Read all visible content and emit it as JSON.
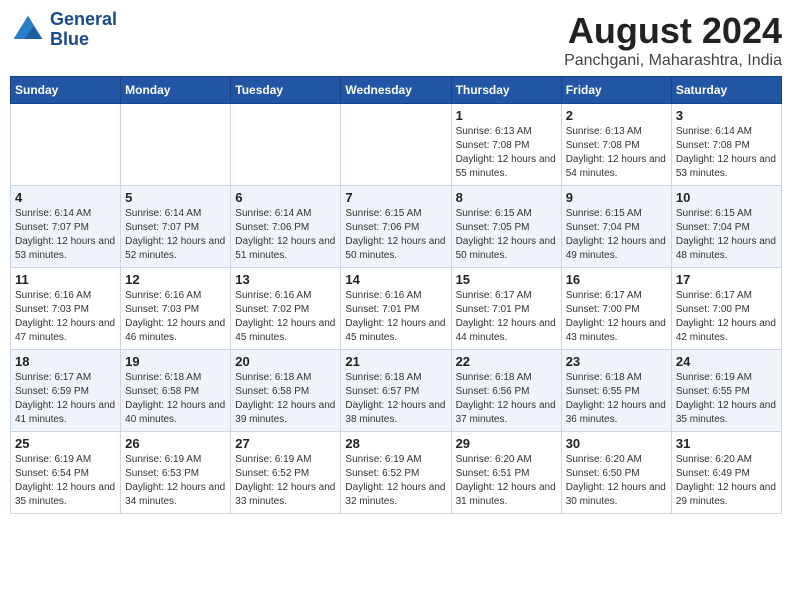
{
  "logo": {
    "line1": "General",
    "line2": "Blue"
  },
  "title": "August 2024",
  "subtitle": "Panchgani, Maharashtra, India",
  "days_of_week": [
    "Sunday",
    "Monday",
    "Tuesday",
    "Wednesday",
    "Thursday",
    "Friday",
    "Saturday"
  ],
  "weeks": [
    [
      {
        "day": "",
        "sunrise": "",
        "sunset": "",
        "daylight": ""
      },
      {
        "day": "",
        "sunrise": "",
        "sunset": "",
        "daylight": ""
      },
      {
        "day": "",
        "sunrise": "",
        "sunset": "",
        "daylight": ""
      },
      {
        "day": "",
        "sunrise": "",
        "sunset": "",
        "daylight": ""
      },
      {
        "day": "1",
        "sunrise": "Sunrise: 6:13 AM",
        "sunset": "Sunset: 7:08 PM",
        "daylight": "Daylight: 12 hours and 55 minutes."
      },
      {
        "day": "2",
        "sunrise": "Sunrise: 6:13 AM",
        "sunset": "Sunset: 7:08 PM",
        "daylight": "Daylight: 12 hours and 54 minutes."
      },
      {
        "day": "3",
        "sunrise": "Sunrise: 6:14 AM",
        "sunset": "Sunset: 7:08 PM",
        "daylight": "Daylight: 12 hours and 53 minutes."
      }
    ],
    [
      {
        "day": "4",
        "sunrise": "Sunrise: 6:14 AM",
        "sunset": "Sunset: 7:07 PM",
        "daylight": "Daylight: 12 hours and 53 minutes."
      },
      {
        "day": "5",
        "sunrise": "Sunrise: 6:14 AM",
        "sunset": "Sunset: 7:07 PM",
        "daylight": "Daylight: 12 hours and 52 minutes."
      },
      {
        "day": "6",
        "sunrise": "Sunrise: 6:14 AM",
        "sunset": "Sunset: 7:06 PM",
        "daylight": "Daylight: 12 hours and 51 minutes."
      },
      {
        "day": "7",
        "sunrise": "Sunrise: 6:15 AM",
        "sunset": "Sunset: 7:06 PM",
        "daylight": "Daylight: 12 hours and 50 minutes."
      },
      {
        "day": "8",
        "sunrise": "Sunrise: 6:15 AM",
        "sunset": "Sunset: 7:05 PM",
        "daylight": "Daylight: 12 hours and 50 minutes."
      },
      {
        "day": "9",
        "sunrise": "Sunrise: 6:15 AM",
        "sunset": "Sunset: 7:04 PM",
        "daylight": "Daylight: 12 hours and 49 minutes."
      },
      {
        "day": "10",
        "sunrise": "Sunrise: 6:15 AM",
        "sunset": "Sunset: 7:04 PM",
        "daylight": "Daylight: 12 hours and 48 minutes."
      }
    ],
    [
      {
        "day": "11",
        "sunrise": "Sunrise: 6:16 AM",
        "sunset": "Sunset: 7:03 PM",
        "daylight": "Daylight: 12 hours and 47 minutes."
      },
      {
        "day": "12",
        "sunrise": "Sunrise: 6:16 AM",
        "sunset": "Sunset: 7:03 PM",
        "daylight": "Daylight: 12 hours and 46 minutes."
      },
      {
        "day": "13",
        "sunrise": "Sunrise: 6:16 AM",
        "sunset": "Sunset: 7:02 PM",
        "daylight": "Daylight: 12 hours and 45 minutes."
      },
      {
        "day": "14",
        "sunrise": "Sunrise: 6:16 AM",
        "sunset": "Sunset: 7:01 PM",
        "daylight": "Daylight: 12 hours and 45 minutes."
      },
      {
        "day": "15",
        "sunrise": "Sunrise: 6:17 AM",
        "sunset": "Sunset: 7:01 PM",
        "daylight": "Daylight: 12 hours and 44 minutes."
      },
      {
        "day": "16",
        "sunrise": "Sunrise: 6:17 AM",
        "sunset": "Sunset: 7:00 PM",
        "daylight": "Daylight: 12 hours and 43 minutes."
      },
      {
        "day": "17",
        "sunrise": "Sunrise: 6:17 AM",
        "sunset": "Sunset: 7:00 PM",
        "daylight": "Daylight: 12 hours and 42 minutes."
      }
    ],
    [
      {
        "day": "18",
        "sunrise": "Sunrise: 6:17 AM",
        "sunset": "Sunset: 6:59 PM",
        "daylight": "Daylight: 12 hours and 41 minutes."
      },
      {
        "day": "19",
        "sunrise": "Sunrise: 6:18 AM",
        "sunset": "Sunset: 6:58 PM",
        "daylight": "Daylight: 12 hours and 40 minutes."
      },
      {
        "day": "20",
        "sunrise": "Sunrise: 6:18 AM",
        "sunset": "Sunset: 6:58 PM",
        "daylight": "Daylight: 12 hours and 39 minutes."
      },
      {
        "day": "21",
        "sunrise": "Sunrise: 6:18 AM",
        "sunset": "Sunset: 6:57 PM",
        "daylight": "Daylight: 12 hours and 38 minutes."
      },
      {
        "day": "22",
        "sunrise": "Sunrise: 6:18 AM",
        "sunset": "Sunset: 6:56 PM",
        "daylight": "Daylight: 12 hours and 37 minutes."
      },
      {
        "day": "23",
        "sunrise": "Sunrise: 6:18 AM",
        "sunset": "Sunset: 6:55 PM",
        "daylight": "Daylight: 12 hours and 36 minutes."
      },
      {
        "day": "24",
        "sunrise": "Sunrise: 6:19 AM",
        "sunset": "Sunset: 6:55 PM",
        "daylight": "Daylight: 12 hours and 35 minutes."
      }
    ],
    [
      {
        "day": "25",
        "sunrise": "Sunrise: 6:19 AM",
        "sunset": "Sunset: 6:54 PM",
        "daylight": "Daylight: 12 hours and 35 minutes."
      },
      {
        "day": "26",
        "sunrise": "Sunrise: 6:19 AM",
        "sunset": "Sunset: 6:53 PM",
        "daylight": "Daylight: 12 hours and 34 minutes."
      },
      {
        "day": "27",
        "sunrise": "Sunrise: 6:19 AM",
        "sunset": "Sunset: 6:52 PM",
        "daylight": "Daylight: 12 hours and 33 minutes."
      },
      {
        "day": "28",
        "sunrise": "Sunrise: 6:19 AM",
        "sunset": "Sunset: 6:52 PM",
        "daylight": "Daylight: 12 hours and 32 minutes."
      },
      {
        "day": "29",
        "sunrise": "Sunrise: 6:20 AM",
        "sunset": "Sunset: 6:51 PM",
        "daylight": "Daylight: 12 hours and 31 minutes."
      },
      {
        "day": "30",
        "sunrise": "Sunrise: 6:20 AM",
        "sunset": "Sunset: 6:50 PM",
        "daylight": "Daylight: 12 hours and 30 minutes."
      },
      {
        "day": "31",
        "sunrise": "Sunrise: 6:20 AM",
        "sunset": "Sunset: 6:49 PM",
        "daylight": "Daylight: 12 hours and 29 minutes."
      }
    ]
  ]
}
